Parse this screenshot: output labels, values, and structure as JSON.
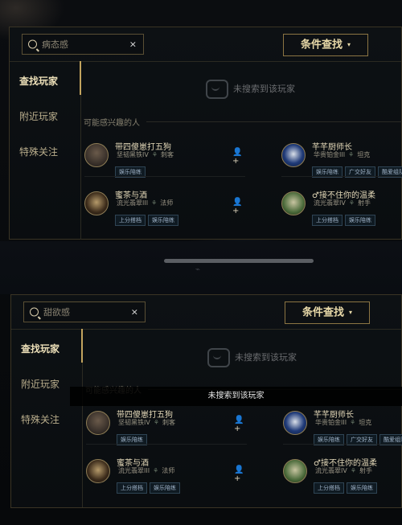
{
  "panels": [
    {
      "search": {
        "value": "病态感",
        "clear": "×"
      },
      "filter": {
        "label": "条件查找",
        "arrow": "▾"
      },
      "nav": [
        {
          "label": "查找玩家"
        },
        {
          "label": "附近玩家"
        },
        {
          "label": "特殊关注"
        }
      ],
      "empty_text": "未搜索到该玩家",
      "section_title": "可能感兴趣的人",
      "players": [
        {
          "name": "带四傻崽打五狗",
          "rank": "坚韧黑铁IV",
          "role": "刺客",
          "tags": [
            "娱乐陪练"
          ]
        },
        {
          "name": "芊芊厨师长",
          "rank": "华贵铂金III",
          "role": "坦克",
          "tags": [
            "娱乐陪练",
            "广交好友",
            "酷爱组队"
          ]
        },
        {
          "name": "蜜茶与酒",
          "rank": "流光翡翠III",
          "role": "法师",
          "tags": [
            "上分搭档",
            "娱乐陪练"
          ]
        },
        {
          "name": "♂接不住你的温柔",
          "rank": "流光翡翠IV",
          "role": "射手",
          "tags": [
            "上分搭档",
            "娱乐陪练"
          ]
        }
      ]
    },
    {
      "search": {
        "value": "甜欲感",
        "clear": "×"
      },
      "filter": {
        "label": "条件查找",
        "arrow": "▾"
      },
      "nav": [
        {
          "label": "查找玩家"
        },
        {
          "label": "附近玩家"
        },
        {
          "label": "特殊关注"
        }
      ],
      "empty_text": "未搜索到该玩家",
      "section_title": "可能感兴趣的人",
      "players": [
        {
          "name": "带四傻崽打五狗",
          "rank": "坚韧黑铁IV",
          "role": "刺客",
          "tags": [
            "娱乐陪练"
          ]
        },
        {
          "name": "芊芊厨师长",
          "rank": "华贵铂金III",
          "role": "坦克",
          "tags": [
            "娱乐陪练",
            "广交好友",
            "酷爱组队"
          ]
        },
        {
          "name": "蜜茶与酒",
          "rank": "流光翡翠III",
          "role": "法师",
          "tags": [
            "上分搭档",
            "娱乐陪练"
          ]
        },
        {
          "name": "♂接不住你的温柔",
          "rank": "流光翡翠IV",
          "role": "射手",
          "tags": [
            "上分搭档",
            "娱乐陪练"
          ]
        }
      ]
    }
  ],
  "toast": "未搜索到该玩家",
  "icons": {
    "search": "search-icon",
    "add": "add-friend-icon",
    "empty": "empty-result-icon"
  },
  "colors": {
    "accent": "#c3a45e",
    "text": "#e4d9b9",
    "tag_text": "#9fb3c8"
  }
}
